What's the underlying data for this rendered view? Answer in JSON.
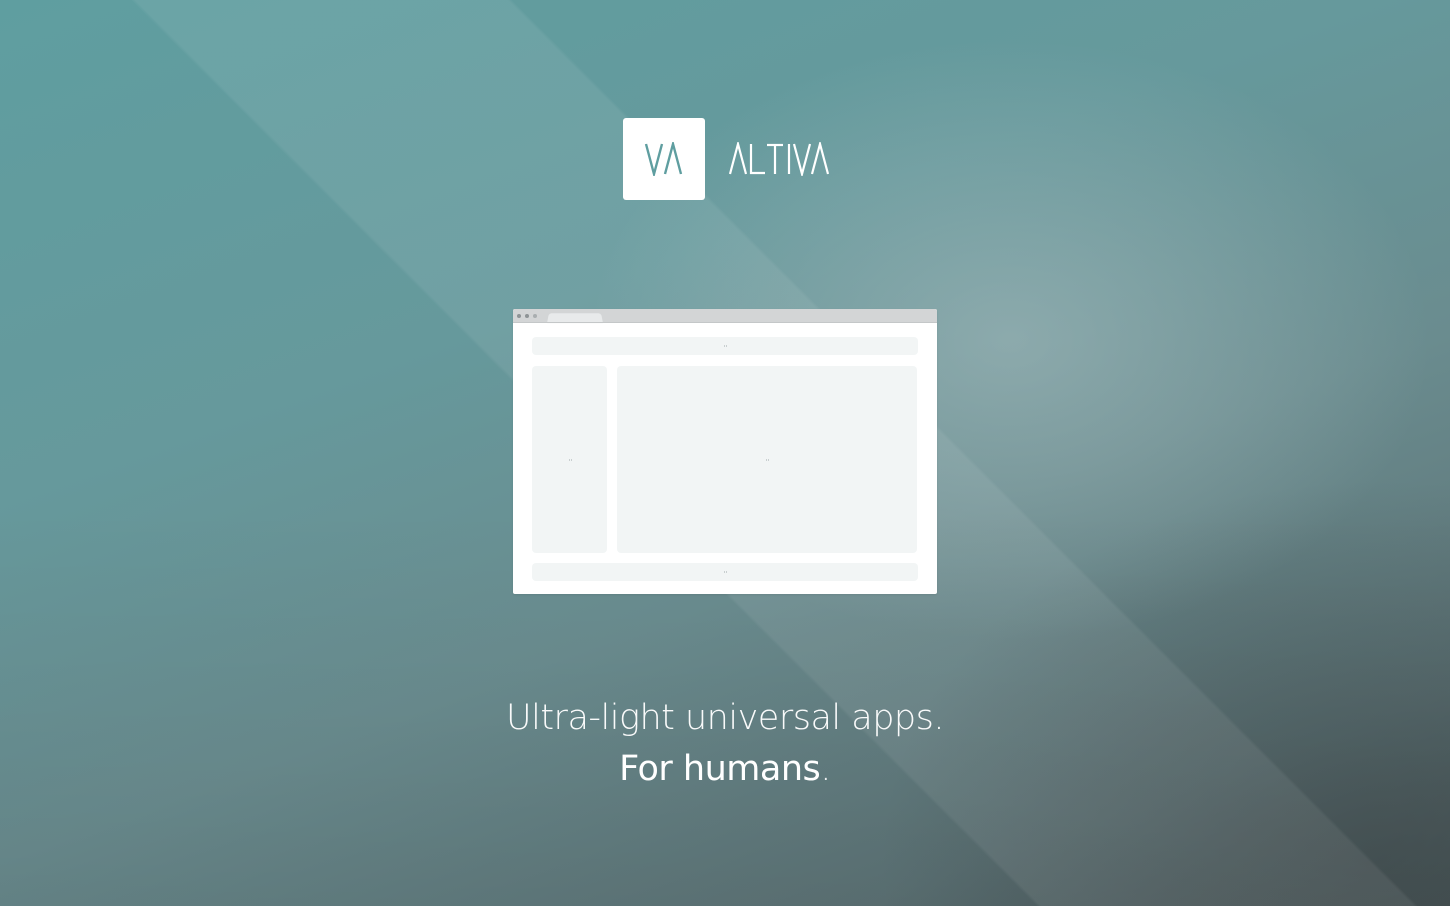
{
  "brand": {
    "mark_text": "VA",
    "name": "ALTIVA",
    "mark_color": "#5f9ea0",
    "wordmark_color": "#ffffff"
  },
  "browser_mockup": {
    "window_controls": [
      "close-dot",
      "minimize-dot",
      "maximize-dot"
    ],
    "panes": [
      "header",
      "sidebar",
      "content",
      "footer"
    ]
  },
  "tagline": {
    "line1": "Ultra-light universal apps.",
    "line2_strong": "For humans",
    "line2_period": "."
  },
  "colors": {
    "background_start": "#5f9ea0",
    "background_end": "#4e5b5d",
    "pane_fill": "#f2f5f5",
    "browser_bar": "#d3d5d6"
  }
}
